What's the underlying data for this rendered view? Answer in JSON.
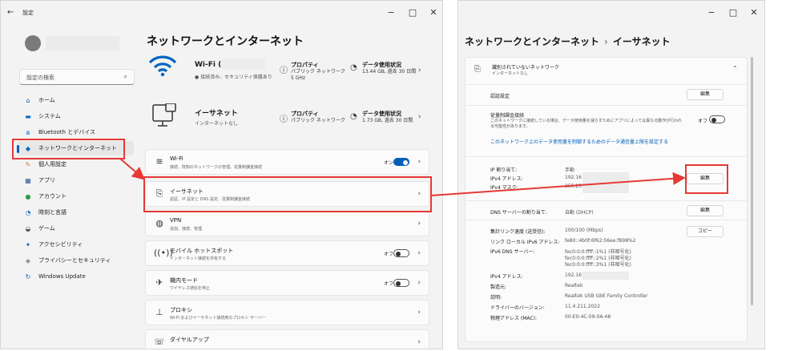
{
  "colors": {
    "accent": "#005fb8",
    "highlight": "#e53935"
  },
  "settings": {
    "title": "設定",
    "back": "←",
    "window_controls": [
      "−",
      "□",
      "✕"
    ],
    "search": {
      "placeholder": "設定の検索",
      "icon": "search-icon"
    },
    "nav": [
      {
        "label": "ホーム",
        "icon": "home-icon",
        "glyph": "⌂"
      },
      {
        "label": "システム",
        "icon": "monitor-icon",
        "glyph": "▬"
      },
      {
        "label": "Bluetooth とデバイス",
        "icon": "bluetooth-icon",
        "glyph": "ʙ"
      },
      {
        "label": "ネットワークとインターネット",
        "icon": "network-icon",
        "glyph": "◆"
      },
      {
        "label": "個人用設定",
        "icon": "brush-icon",
        "glyph": "✎"
      },
      {
        "label": "アプリ",
        "icon": "apps-icon",
        "glyph": "▦"
      },
      {
        "label": "アカウント",
        "icon": "person-icon",
        "glyph": "●"
      },
      {
        "label": "時刻と言語",
        "icon": "globe-clock-icon",
        "glyph": "◔"
      },
      {
        "label": "ゲーム",
        "icon": "gamepad-icon",
        "glyph": "◒"
      },
      {
        "label": "アクセシビリティ",
        "icon": "accessibility-icon",
        "glyph": "✦"
      },
      {
        "label": "プライバシーとセキュリティ",
        "icon": "shield-icon",
        "glyph": "◈"
      },
      {
        "label": "Windows Update",
        "icon": "update-icon",
        "glyph": "↻"
      }
    ],
    "page_title": "ネットワークとインターネット",
    "wifi_hero": {
      "name": "Wi-Fi (",
      "status": "● 接続済み、セキュリティ保護あり",
      "prop_title": "プロパティ",
      "prop_sub1": "パブリック ネットワーク",
      "prop_sub2": "5 GHz",
      "usage_title": "データ使用状況",
      "usage_sub": "13.44 GB, 過去 30 日間"
    },
    "ethernet_hero": {
      "name": "イーサネット",
      "status": "インターネットなし",
      "prop_title": "プロパティ",
      "prop_sub1": "パブリック ネットワーク",
      "usage_title": "データ使用状況",
      "usage_sub": "1.73 GB, 過去 30 日間"
    },
    "cards": [
      {
        "title": "Wi-Fi",
        "sub": "接続、既知のネットワークの管理、従量制課金接続",
        "state": "オン",
        "toggle": true,
        "icon": "wifi-icon",
        "glyph": "≋"
      },
      {
        "title": "イーサネット",
        "sub": "認証、IP 設定と DNS 設定、従量制課金接続",
        "icon": "ethernet-icon",
        "glyph": "⎘"
      },
      {
        "title": "VPN",
        "sub": "追加、接続、管理",
        "icon": "vpn-icon",
        "glyph": "◍"
      },
      {
        "title": "モバイル ホットスポット",
        "sub": "インターネット接続を共有する",
        "state": "オフ",
        "toggle": false,
        "icon": "hotspot-icon",
        "glyph": "((•))"
      },
      {
        "title": "機内モード",
        "sub": "ワイヤレス通信を停止",
        "state": "オフ",
        "toggle": false,
        "icon": "airplane-icon",
        "glyph": "✈"
      },
      {
        "title": "プロキシ",
        "sub": "Wi-Fi およびイーサネット接続用のプロキシ サーバー",
        "icon": "proxy-icon",
        "glyph": "⊥"
      },
      {
        "title": "ダイヤルアップ",
        "sub": "",
        "icon": "dialup-icon",
        "glyph": "☏"
      }
    ]
  },
  "ethernet": {
    "breadcrumb_parent": "ネットワークとインターネット",
    "breadcrumb_sep": "›",
    "breadcrumb_current": "イーサネット",
    "network_name": "識別されていないネットワーク",
    "network_status": "インターネットなし",
    "auth_label": "認証設定",
    "edit_label": "編集",
    "metered_label": "従量制課金接続",
    "metered_desc1": "このネットワークに接続している場合、データ使用量を減らすためにアプリによっては異なる動作が行われ",
    "metered_desc2": "る可能性があります。",
    "metered_state": "オフ",
    "data_limit_link": "このネットワーク上のデータ使用量を制御するためのデータ通信量上限を設定する",
    "ip_rows": [
      {
        "label": "IP 割り当て:",
        "value": "手動"
      },
      {
        "label": "IPv4 アドレス:",
        "value": "192.16"
      },
      {
        "label": "IPv4 マスク:",
        "value": "255.25"
      }
    ],
    "dns_label": "DNS サーバーの割り当て:",
    "dns_value": "自動 (DHCP)",
    "copy_label": "コピー",
    "info_rows": [
      {
        "label": "集計リンク速度 (送受信):",
        "value": "100/100 (Mbps)"
      },
      {
        "label": "リンク ローカル IPv6 アドレス:",
        "value": "fe80::4b0f:6f62:56ee:f898%2"
      },
      {
        "label": "IPv6 DNS サーバー:",
        "value": "fec0:0:0:ffff::1%1 (非暗号化)"
      },
      {
        "label": "",
        "value": "fec0:0:0:ffff::2%1 (非暗号化)"
      },
      {
        "label": "",
        "value": "fec0:0:0:ffff::3%1 (非暗号化)"
      },
      {
        "label": "IPv4 アドレス:",
        "value": "192.16"
      },
      {
        "label": "製造元:",
        "value": "Realtek"
      },
      {
        "label": "説明:",
        "value": "Realtek USB GbE Family Controller"
      },
      {
        "label": "ドライバーのバージョン:",
        "value": "11.4.211.2022"
      },
      {
        "label": "物理アドレス (MAC):",
        "value": "00-E0-4C-09-0A-48"
      }
    ]
  }
}
